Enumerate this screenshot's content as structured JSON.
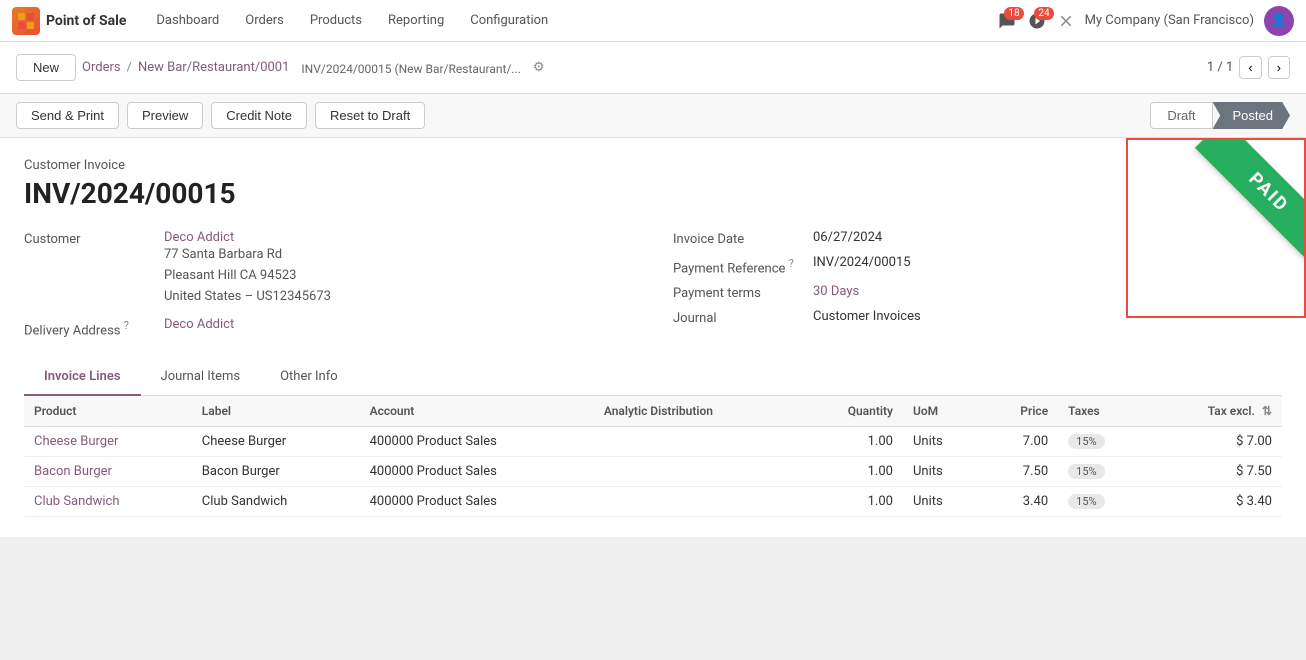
{
  "app": {
    "logo_text": "POS",
    "name": "Point of Sale"
  },
  "nav": {
    "items": [
      {
        "id": "dashboard",
        "label": "Dashboard"
      },
      {
        "id": "orders",
        "label": "Orders"
      },
      {
        "id": "products",
        "label": "Products"
      },
      {
        "id": "reporting",
        "label": "Reporting"
      },
      {
        "id": "configuration",
        "label": "Configuration"
      }
    ],
    "notifications": "18",
    "activities": "24",
    "company": "My Company (San Francisco)"
  },
  "breadcrumb": {
    "new_label": "New",
    "orders_label": "Orders",
    "separator": "/",
    "parent_label": "New Bar/Restaurant/0001",
    "current_label": "INV/2024/00015 (New Bar/Restaurant/...",
    "pagination": "1 / 1"
  },
  "actions": {
    "send_print": "Send & Print",
    "preview": "Preview",
    "credit_note": "Credit Note",
    "reset_to_draft": "Reset to Draft",
    "status_draft": "Draft",
    "status_posted": "Posted"
  },
  "invoice": {
    "type": "Customer Invoice",
    "number": "INV/2024/00015",
    "customer_label": "Customer",
    "customer_name": "Deco Addict",
    "customer_address_line1": "77 Santa Barbara Rd",
    "customer_address_line2": "Pleasant Hill CA 94523",
    "customer_address_line3": "United States – US12345673",
    "delivery_address_label": "Delivery Address",
    "delivery_address_name": "Deco Addict",
    "invoice_date_label": "Invoice Date",
    "invoice_date": "06/27/2024",
    "payment_reference_label": "Payment Reference",
    "payment_reference": "INV/2024/00015",
    "payment_terms_label": "Payment terms",
    "payment_terms": "30 Days",
    "journal_label": "Journal",
    "journal": "Customer Invoices",
    "paid_stamp": "PAID"
  },
  "tabs": [
    {
      "id": "invoice-lines",
      "label": "Invoice Lines",
      "active": true
    },
    {
      "id": "journal-items",
      "label": "Journal Items",
      "active": false
    },
    {
      "id": "other-info",
      "label": "Other Info",
      "active": false
    }
  ],
  "table": {
    "columns": [
      {
        "id": "product",
        "label": "Product"
      },
      {
        "id": "label",
        "label": "Label"
      },
      {
        "id": "account",
        "label": "Account"
      },
      {
        "id": "analytic",
        "label": "Analytic Distribution"
      },
      {
        "id": "quantity",
        "label": "Quantity",
        "align": "right"
      },
      {
        "id": "uom",
        "label": "UoM"
      },
      {
        "id": "price",
        "label": "Price",
        "align": "right"
      },
      {
        "id": "taxes",
        "label": "Taxes"
      },
      {
        "id": "tax_excl",
        "label": "Tax excl.",
        "align": "right"
      }
    ],
    "rows": [
      {
        "product": "Cheese Burger",
        "label": "Cheese Burger",
        "account": "400000 Product Sales",
        "analytic": "",
        "quantity": "1.00",
        "uom": "Units",
        "price": "7.00",
        "taxes": "15%",
        "tax_excl": "$ 7.00"
      },
      {
        "product": "Bacon Burger",
        "label": "Bacon Burger",
        "account": "400000 Product Sales",
        "analytic": "",
        "quantity": "1.00",
        "uom": "Units",
        "price": "7.50",
        "taxes": "15%",
        "tax_excl": "$ 7.50"
      },
      {
        "product": "Club Sandwich",
        "label": "Club Sandwich",
        "account": "400000 Product Sales",
        "analytic": "",
        "quantity": "1.00",
        "uom": "Units",
        "price": "3.40",
        "taxes": "15%",
        "tax_excl": "$ 3.40"
      }
    ]
  }
}
